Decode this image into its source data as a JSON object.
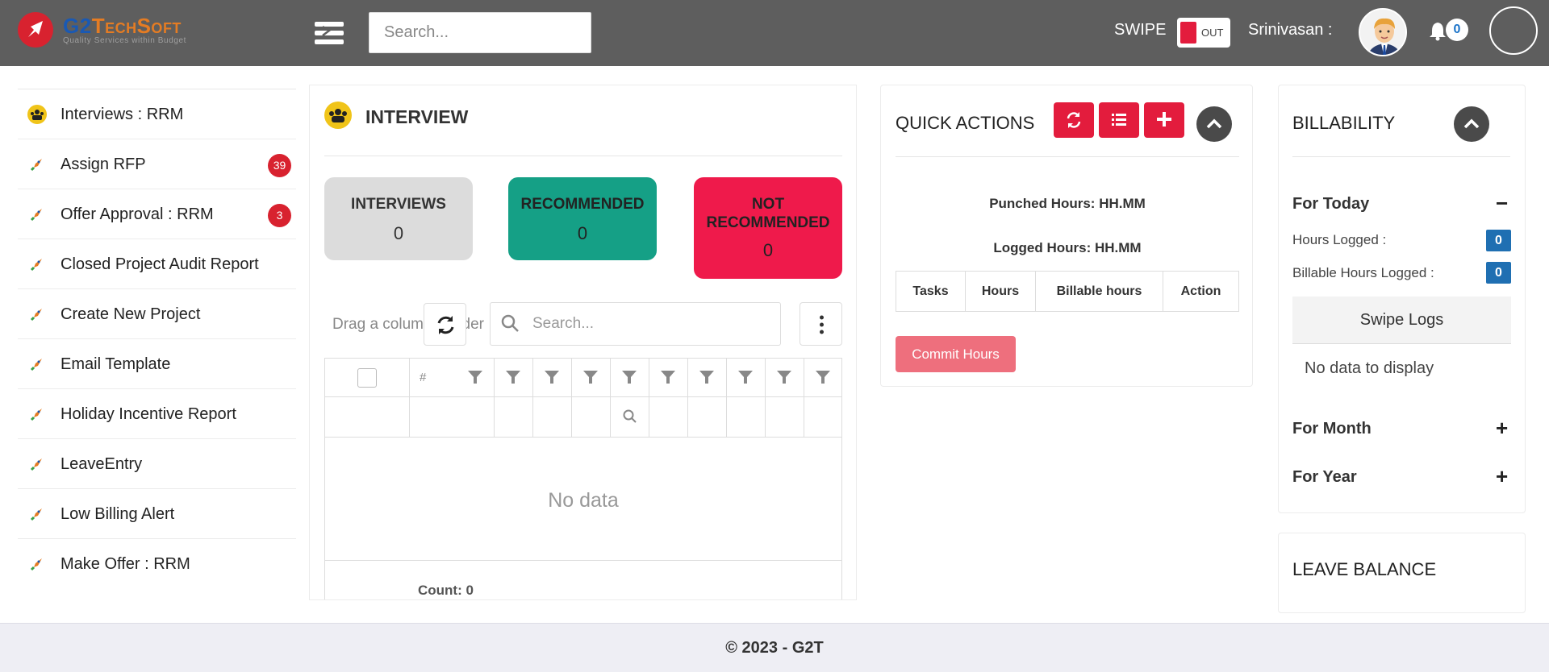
{
  "brand": {
    "name_part1": "G2",
    "name_part2": "Tech",
    "name_part3": "S",
    "name_part4": "o",
    "name_part5": "ft",
    "tagline": "Quality Services within Budget",
    "accent": "#d8222f"
  },
  "header": {
    "search_placeholder": "Search...",
    "swipe_label": "SWIPE",
    "swipe_state": "OUT",
    "username": "Srinivasan :",
    "notification_count": "0"
  },
  "sidebar": {
    "items": [
      {
        "label": "Interviews : RRM",
        "icon": "interview-icon",
        "badge": ""
      },
      {
        "label": "Assign RFP",
        "icon": "rocket-icon",
        "badge": "39"
      },
      {
        "label": "Offer Approval : RRM",
        "icon": "rocket-icon",
        "badge": "3"
      },
      {
        "label": "Closed Project Audit Report",
        "icon": "rocket-icon",
        "badge": ""
      },
      {
        "label": "Create New Project",
        "icon": "rocket-icon",
        "badge": ""
      },
      {
        "label": "Email Template",
        "icon": "rocket-icon",
        "badge": ""
      },
      {
        "label": "Holiday Incentive Report",
        "icon": "rocket-icon",
        "badge": ""
      },
      {
        "label": "LeaveEntry",
        "icon": "rocket-icon",
        "badge": ""
      },
      {
        "label": "Low Billing Alert",
        "icon": "rocket-icon",
        "badge": ""
      },
      {
        "label": "Make Offer : RRM",
        "icon": "rocket-icon",
        "badge": ""
      }
    ]
  },
  "interview": {
    "title": "INTERVIEW",
    "stats": [
      {
        "label": "INTERVIEWS",
        "value": "0",
        "color": "#dcdcdc"
      },
      {
        "label": "RECOMMENDED",
        "value": "0",
        "color": "#15a086"
      },
      {
        "label": "NOT RECOMMENDED",
        "value": "0",
        "color": "#ef1a4b"
      }
    ],
    "drag_hint": "Drag a column header",
    "search_placeholder": "Search...",
    "columns": [
      "#"
    ],
    "no_data": "No data",
    "count": "Count: 0"
  },
  "quick_actions": {
    "title": "QUICK ACTIONS",
    "punched": "Punched Hours: HH.MM",
    "logged": "Logged Hours: HH.MM",
    "table_headers": [
      "Tasks",
      "Hours",
      "Billable hours",
      "Action"
    ],
    "commit_label": "Commit Hours"
  },
  "billability": {
    "title": "BILLABILITY",
    "today": "For Today",
    "today_sign": "−",
    "hours_logged_label": "Hours Logged :",
    "hours_logged_value": "0",
    "billable_label": "Billable Hours Logged :",
    "billable_value": "0",
    "swipe_logs": "Swipe Logs",
    "no_data": "No data to display",
    "month": "For Month",
    "month_sign": "+",
    "year": "For Year",
    "year_sign": "+"
  },
  "leave_balance": {
    "title": "LEAVE BALANCE"
  },
  "footer": {
    "text": "© 2023 - G2T"
  }
}
